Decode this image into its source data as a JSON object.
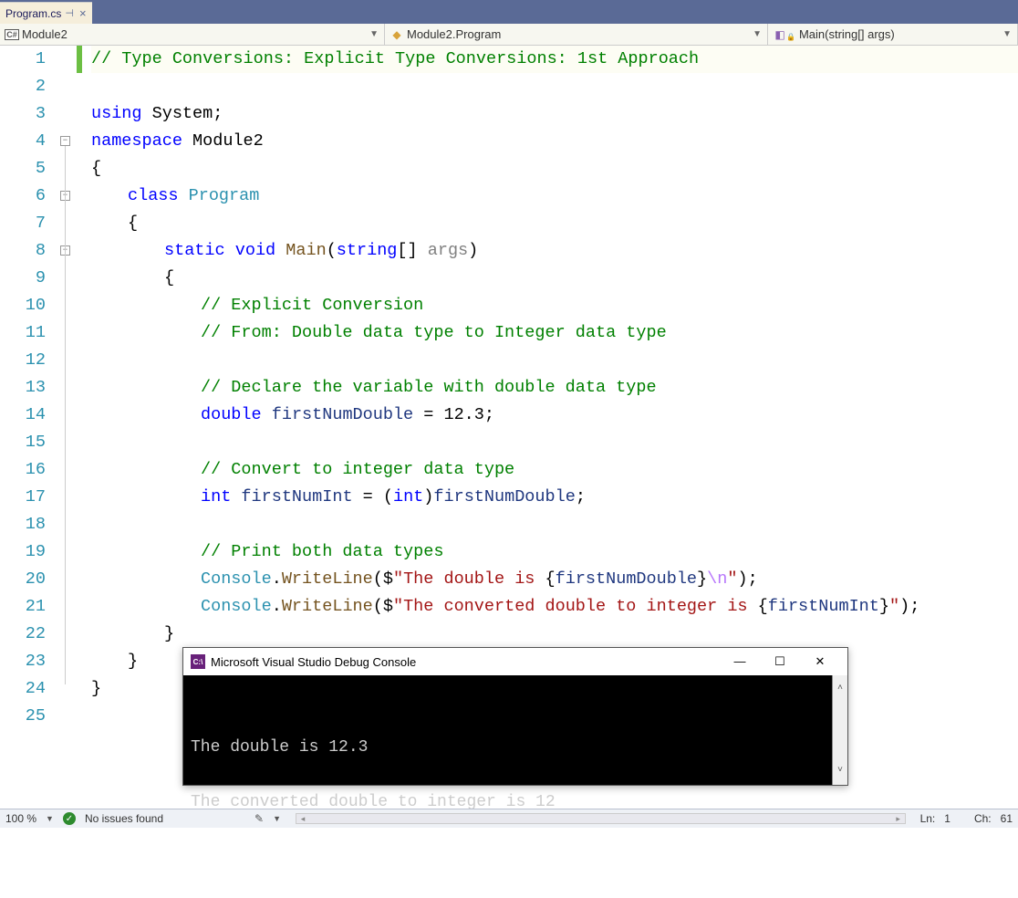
{
  "tab": {
    "title": "Program.cs"
  },
  "breadcrumb": {
    "project": "Module2",
    "class": "Module2.Program",
    "method": "Main(string[] args)"
  },
  "code": {
    "lines": [
      {
        "n": 1,
        "indent": 0,
        "tokens": [
          [
            "c-comment",
            "// Type Conversions: Explicit Type Conversions: 1st Approach"
          ]
        ]
      },
      {
        "n": 2,
        "indent": 0,
        "tokens": []
      },
      {
        "n": 3,
        "indent": 0,
        "tokens": [
          [
            "c-key",
            "using"
          ],
          [
            "c-text",
            " System;"
          ]
        ]
      },
      {
        "n": 4,
        "indent": 0,
        "tokens": [
          [
            "c-key",
            "namespace"
          ],
          [
            "c-text",
            " Module2"
          ]
        ]
      },
      {
        "n": 5,
        "indent": 0,
        "tokens": [
          [
            "c-text",
            "{"
          ]
        ]
      },
      {
        "n": 6,
        "indent": 1,
        "tokens": [
          [
            "c-key",
            "class"
          ],
          [
            "c-text",
            " "
          ],
          [
            "c-type",
            "Program"
          ]
        ]
      },
      {
        "n": 7,
        "indent": 1,
        "tokens": [
          [
            "c-text",
            "{"
          ]
        ]
      },
      {
        "n": 8,
        "indent": 2,
        "tokens": [
          [
            "c-key",
            "static"
          ],
          [
            "c-text",
            " "
          ],
          [
            "c-key",
            "void"
          ],
          [
            "c-text",
            " "
          ],
          [
            "c-method",
            "Main"
          ],
          [
            "c-text",
            "("
          ],
          [
            "c-key",
            "string"
          ],
          [
            "c-text",
            "[] "
          ],
          [
            "c-param",
            "args"
          ],
          [
            "c-text",
            ")"
          ]
        ]
      },
      {
        "n": 9,
        "indent": 2,
        "tokens": [
          [
            "c-text",
            "{"
          ]
        ]
      },
      {
        "n": 10,
        "indent": 3,
        "tokens": [
          [
            "c-comment",
            "// Explicit Conversion"
          ]
        ]
      },
      {
        "n": 11,
        "indent": 3,
        "tokens": [
          [
            "c-comment",
            "// From: Double data type to Integer data type"
          ]
        ]
      },
      {
        "n": 12,
        "indent": 3,
        "tokens": []
      },
      {
        "n": 13,
        "indent": 3,
        "tokens": [
          [
            "c-comment",
            "// Declare the variable with double data type"
          ]
        ]
      },
      {
        "n": 14,
        "indent": 3,
        "tokens": [
          [
            "c-key",
            "double"
          ],
          [
            "c-text",
            " "
          ],
          [
            "c-ident",
            "firstNumDouble"
          ],
          [
            "c-text",
            " = 12.3;"
          ]
        ]
      },
      {
        "n": 15,
        "indent": 3,
        "tokens": []
      },
      {
        "n": 16,
        "indent": 3,
        "tokens": [
          [
            "c-comment",
            "// Convert to integer data type"
          ]
        ]
      },
      {
        "n": 17,
        "indent": 3,
        "tokens": [
          [
            "c-key",
            "int"
          ],
          [
            "c-text",
            " "
          ],
          [
            "c-ident",
            "firstNumInt"
          ],
          [
            "c-text",
            " = ("
          ],
          [
            "c-key",
            "int"
          ],
          [
            "c-text",
            ")"
          ],
          [
            "c-ident",
            "firstNumDouble"
          ],
          [
            "c-text",
            ";"
          ]
        ]
      },
      {
        "n": 18,
        "indent": 3,
        "tokens": []
      },
      {
        "n": 19,
        "indent": 3,
        "tokens": [
          [
            "c-comment",
            "// Print both data types"
          ]
        ]
      },
      {
        "n": 20,
        "indent": 3,
        "tokens": [
          [
            "c-type",
            "Console"
          ],
          [
            "c-text",
            "."
          ],
          [
            "c-method",
            "WriteLine"
          ],
          [
            "c-text",
            "($"
          ],
          [
            "c-str",
            "\"The double is "
          ],
          [
            "c-text",
            "{"
          ],
          [
            "c-interp",
            "firstNumDouble"
          ],
          [
            "c-text",
            "}"
          ],
          [
            "c-escape",
            "\\n"
          ],
          [
            "c-str",
            "\""
          ],
          [
            "c-text",
            ");"
          ]
        ]
      },
      {
        "n": 21,
        "indent": 3,
        "tokens": [
          [
            "c-type",
            "Console"
          ],
          [
            "c-text",
            "."
          ],
          [
            "c-method",
            "WriteLine"
          ],
          [
            "c-text",
            "($"
          ],
          [
            "c-str",
            "\"The converted double to integer is "
          ],
          [
            "c-text",
            "{"
          ],
          [
            "c-interp",
            "firstNumInt"
          ],
          [
            "c-text",
            "}"
          ],
          [
            "c-str",
            "\""
          ],
          [
            "c-text",
            ");"
          ]
        ]
      },
      {
        "n": 22,
        "indent": 2,
        "tokens": [
          [
            "c-text",
            "}"
          ]
        ]
      },
      {
        "n": 23,
        "indent": 1,
        "tokens": [
          [
            "c-text",
            "}"
          ]
        ]
      },
      {
        "n": 24,
        "indent": 0,
        "tokens": [
          [
            "c-text",
            "}"
          ]
        ]
      },
      {
        "n": 25,
        "indent": 0,
        "tokens": []
      }
    ],
    "folds": [
      {
        "line": 4,
        "sym": "−"
      },
      {
        "line": 6,
        "sym": "−"
      },
      {
        "line": 8,
        "sym": "−"
      }
    ],
    "change_bar": {
      "line": 1
    }
  },
  "console": {
    "title": "Microsoft Visual Studio Debug Console",
    "lines": [
      "The double is 12.3",
      "",
      "The converted double to integer is 12"
    ]
  },
  "status": {
    "zoom": "100 %",
    "issues": "No issues found",
    "ln_label": "Ln:",
    "ln": "1",
    "ch_label": "Ch:",
    "ch": "61"
  }
}
